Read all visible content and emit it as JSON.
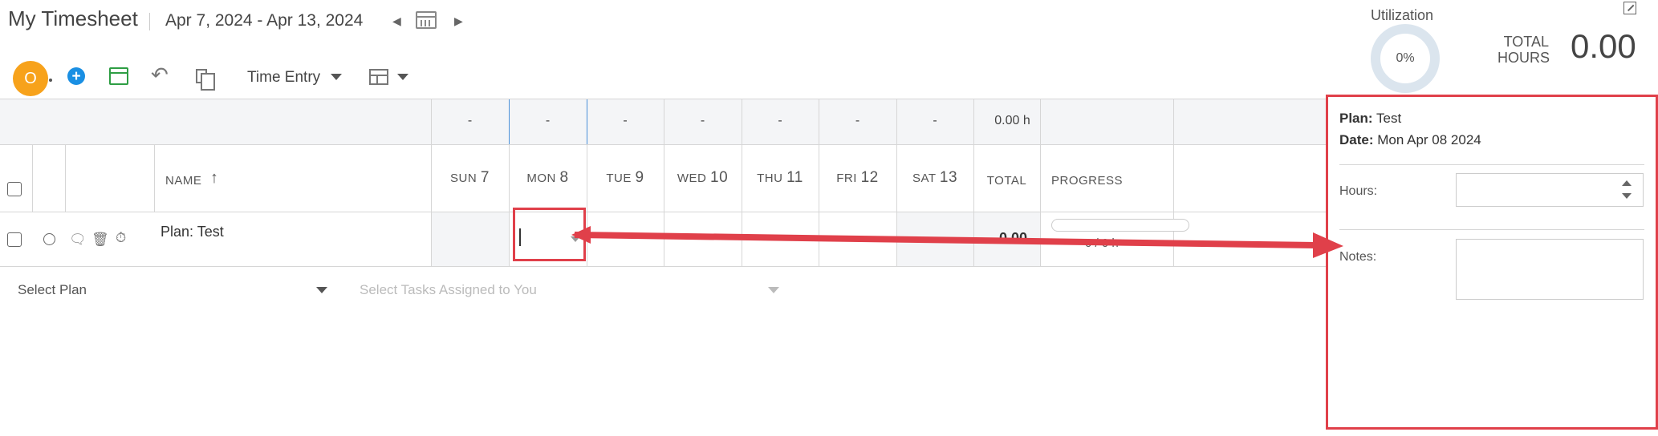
{
  "header": {
    "title": "My Timesheet",
    "date_range": "Apr 7, 2024 - Apr 13, 2024",
    "prev_icon": "◀",
    "next_icon": "▶",
    "utilization_label": "Utilization",
    "utilization_value": "0%",
    "total_hours_label_line1": "TOTAL",
    "total_hours_label_line2": "HOURS",
    "total_hours_value": "0.00"
  },
  "toolbar": {
    "avatar_initial": "O",
    "add_icon": "+",
    "undo_icon": "↶",
    "view_mode": "Time Entry"
  },
  "summary": {
    "days": [
      "-",
      "-",
      "-",
      "-",
      "-",
      "-",
      "-"
    ],
    "total": "0.00 h"
  },
  "columns": {
    "name": "NAME",
    "sort_icon": "↑",
    "days": [
      {
        "dow": "SUN",
        "num": "7"
      },
      {
        "dow": "MON",
        "num": "8"
      },
      {
        "dow": "TUE",
        "num": "9"
      },
      {
        "dow": "WED",
        "num": "10"
      },
      {
        "dow": "THU",
        "num": "11"
      },
      {
        "dow": "FRI",
        "num": "12"
      },
      {
        "dow": "SAT",
        "num": "13"
      }
    ],
    "total": "TOTAL",
    "progress": "PROGRESS"
  },
  "row": {
    "plan_name": "Plan: Test",
    "total": "0.00",
    "progress": "0 / 0 h"
  },
  "add_row": {
    "select_plan": "Select Plan",
    "select_tasks": "Select Tasks Assigned to You"
  },
  "panel": {
    "plan_label": "Plan:",
    "plan_value": "Test",
    "date_label": "Date:",
    "date_value": "Mon Apr 08 2024",
    "hours_label": "Hours:",
    "hours_value": "",
    "notes_label": "Notes:",
    "notes_value": ""
  },
  "colors": {
    "accent_orange": "#f7a21b",
    "accent_blue": "#1a8fe3",
    "accent_green": "#2e9e44",
    "highlight_red": "#e0404a"
  }
}
